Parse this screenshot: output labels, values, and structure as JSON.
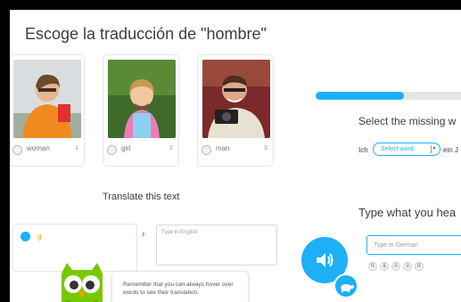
{
  "lesson": {
    "prompt_title": "Escoge la traducción de \"hombre\"",
    "choices": [
      {
        "label": "woman",
        "number": "1"
      },
      {
        "label": "girl",
        "number": "2"
      },
      {
        "label": "man",
        "number": "3"
      }
    ],
    "translate_heading": "Translate this text",
    "source_word": "g",
    "answer_placeholder": "Type in English",
    "tip_text": "Remember that you can always hover over words to see their translation."
  },
  "right_panel": {
    "progress_fraction": 0.58,
    "missing_word_title": "Select the missing w",
    "sentence_start": "Ich",
    "select_placeholder": "Select word",
    "sentence_end": "ein J",
    "listen_title": "Type what you hea",
    "german_placeholder": "Type in German",
    "special_chars": [
      "ß",
      "ä",
      "ö",
      "ü",
      "ß"
    ]
  },
  "colors": {
    "accent": "#1cb0f6",
    "owl_green": "#78c800",
    "progress_track": "#e5e5e5"
  }
}
